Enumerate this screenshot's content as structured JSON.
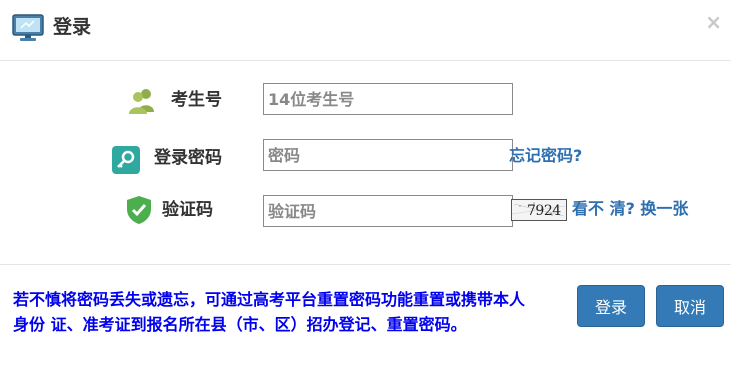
{
  "dialog": {
    "title": "登录",
    "close_label": "×"
  },
  "form": {
    "candidate_number": {
      "label": "考生号",
      "placeholder": "14位考生号"
    },
    "password": {
      "label": "登录密码",
      "placeholder": "密码",
      "forgot_link": "忘记密码?"
    },
    "captcha": {
      "label": "验证码",
      "placeholder": "验证码",
      "image_text": "7924",
      "refresh_link": "看不 清? 换一张"
    }
  },
  "footer": {
    "notice": "若不慎将密码丢失或遗忘，可通过高考平台重置密码功能重置或携带本人身份 证、准考证到报名所在县（市、区）招办登记、重置密码。",
    "login_button": "登录",
    "cancel_button": "取消"
  },
  "colors": {
    "primary_button": "#337ab7",
    "link": "#2e6fb0",
    "notice_text": "#0000ee",
    "title_text": "#333333"
  },
  "icons": {
    "header": "monitor-icon",
    "candidate_number": "users-icon",
    "password": "key-icon",
    "captcha": "shield-check-icon",
    "close": "close-icon"
  }
}
